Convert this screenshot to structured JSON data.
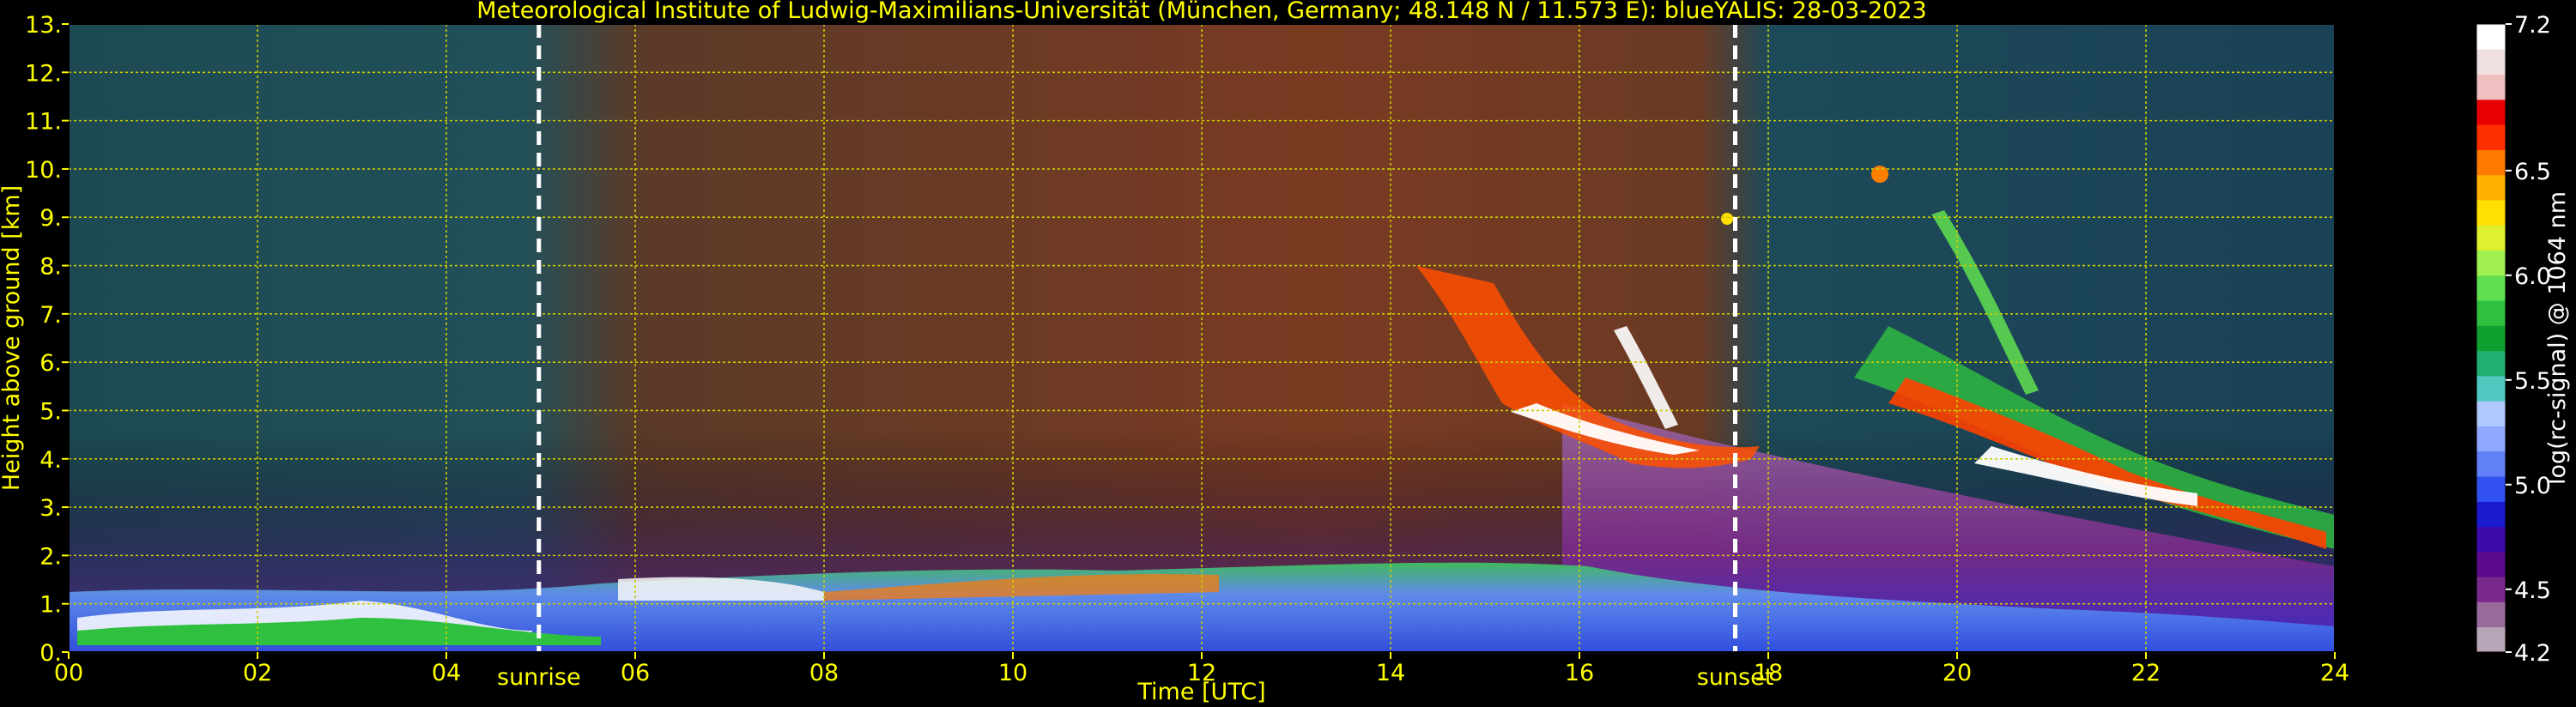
{
  "chart_data": {
    "type": "heatmap",
    "title": "Meteorological Institute of Ludwig-Maximilians-Universität (München, Germany; 48.148 N / 11.573 E):     blueYALIS: 28-03-2023",
    "xlabel": "Time [UTC]",
    "ylabel": "Height above ground [km]",
    "colorbar_label": "log(rc-signal) @ 1064 nm",
    "xlim": [
      0,
      24
    ],
    "ylim": [
      0,
      13
    ],
    "x_ticks": [
      "00",
      "02",
      "04",
      "06",
      "08",
      "10",
      "12",
      "14",
      "16",
      "18",
      "20",
      "22",
      "24"
    ],
    "y_ticks": [
      "0.",
      "1.",
      "2.",
      "3.",
      "4.",
      "5.",
      "6.",
      "7.",
      "8.",
      "9.",
      "10.",
      "11.",
      "12.",
      "13."
    ],
    "colorbar_range": [
      4.2,
      7.2
    ],
    "colorbar_ticks": [
      "4.2",
      "4.5",
      "5.0",
      "5.5",
      "6.0",
      "6.5",
      "7.2"
    ],
    "grid": true,
    "vlines": [
      {
        "label": "sunrise",
        "x": 4.98
      },
      {
        "label": "sunset",
        "x": 17.65
      }
    ],
    "colors": {
      "text": "#ffff00",
      "grid": "#cccc00",
      "colorbar_text": "#ffffff",
      "colormap": [
        "#b8a6b8",
        "#9a6a9a",
        "#7a2a8a",
        "#5a0a8a",
        "#3a0aaa",
        "#1a1ad0",
        "#3050f0",
        "#6080f8",
        "#90a8ff",
        "#b0c8ff",
        "#50c8c0",
        "#20b070",
        "#10a030",
        "#30c040",
        "#60e050",
        "#a0f050",
        "#e0f030",
        "#ffe000",
        "#ffb000",
        "#ff7a00",
        "#ff3000",
        "#e80000",
        "#f0c0c0",
        "#f0e0e0",
        "#ffffff"
      ]
    }
  }
}
